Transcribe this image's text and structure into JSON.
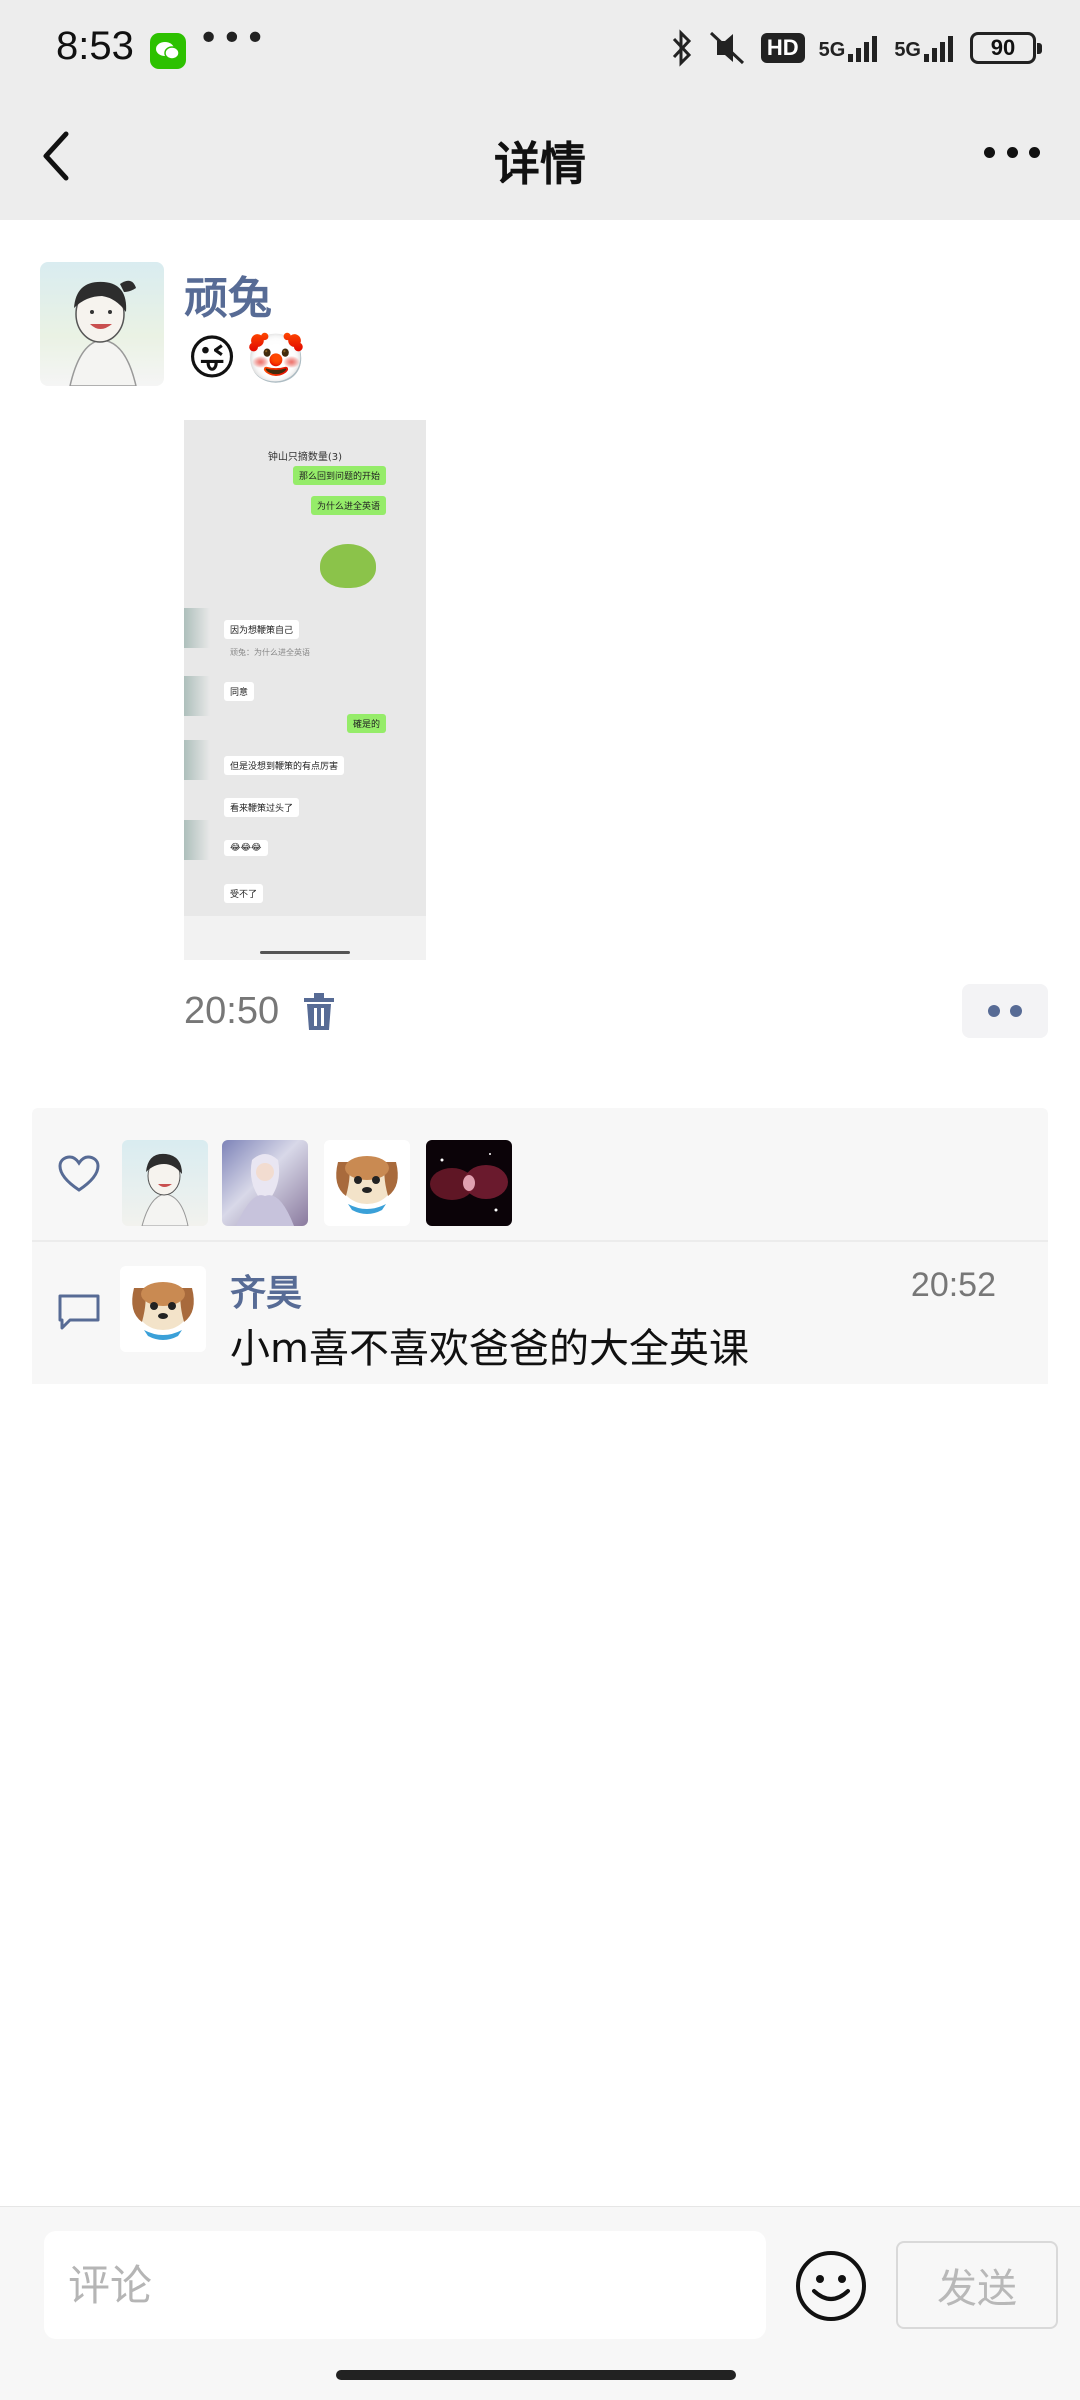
{
  "status_bar": {
    "time": "8:53",
    "app_icon": "wechat-icon",
    "more_indicator": "•••",
    "network_hd": "HD",
    "network_5g_1": "5G",
    "network_5g_2": "5G",
    "battery": "90"
  },
  "header": {
    "title": "详情",
    "back_icon": "chevron-left-icon",
    "more_icon": "more-icon"
  },
  "post": {
    "author": "顽兔",
    "emojis": [
      "😜",
      "🤡"
    ],
    "time": "20:50",
    "image": {
      "chat_title": "钟山只摘数量(3)",
      "messages": [
        {
          "side": "right",
          "text": "那么回到问题的开始"
        },
        {
          "side": "right",
          "text": "为什么进全英语"
        },
        {
          "side": "left",
          "text": "因为想鞭策自己"
        },
        {
          "side": "left",
          "text": "顽兔：为什么进全英语"
        },
        {
          "side": "left",
          "text": "同意"
        },
        {
          "side": "right",
          "text": "確是的"
        },
        {
          "side": "left",
          "text": "但是没想到鞭策的有点厉害"
        },
        {
          "side": "left",
          "text": "看来鞭策过头了"
        },
        {
          "side": "left",
          "text": "😂😂😂"
        },
        {
          "side": "left",
          "text": "受不了"
        }
      ]
    }
  },
  "likes": {
    "icon": "heart-icon",
    "avatars": [
      "avatar-girl",
      "avatar-anime",
      "avatar-dog",
      "avatar-nebula"
    ]
  },
  "comments": [
    {
      "author": "齐昊",
      "time": "20:52",
      "text": "小m喜不喜欢爸爸的大全英课"
    }
  ],
  "input": {
    "placeholder": "评论",
    "send_label": "发送",
    "emoji_icon": "smile-icon"
  },
  "colors": {
    "link_blue": "#576b95",
    "header_bg": "#ededed",
    "panel_bg": "#f7f7f7"
  }
}
